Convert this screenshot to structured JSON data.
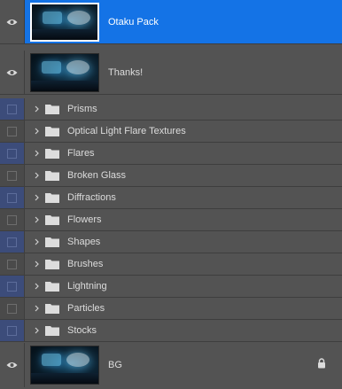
{
  "layers_panel": {
    "top_layers": [
      {
        "name": "Otaku Pack",
        "selected": true,
        "visible": true
      },
      {
        "name": "Thanks!",
        "selected": false,
        "visible": true
      }
    ],
    "groups": [
      {
        "name": "Prisms",
        "color": "blue"
      },
      {
        "name": "Optical Light Flare Textures",
        "color": "gray"
      },
      {
        "name": "Flares",
        "color": "blue"
      },
      {
        "name": "Broken Glass",
        "color": "gray"
      },
      {
        "name": "Diffractions",
        "color": "blue"
      },
      {
        "name": "Flowers",
        "color": "gray"
      },
      {
        "name": "Shapes",
        "color": "blue"
      },
      {
        "name": "Brushes",
        "color": "gray"
      },
      {
        "name": "Lightning",
        "color": "blue"
      },
      {
        "name": "Particles",
        "color": "gray"
      },
      {
        "name": "Stocks",
        "color": "blue"
      }
    ],
    "background_layer": {
      "name": "BG",
      "visible": true,
      "locked": true
    }
  },
  "icons": {
    "visibility": "eye-icon",
    "expand": "chevron-right-icon",
    "group": "folder-icon",
    "lock": "lock-icon"
  },
  "colors": {
    "panel_bg": "#535353",
    "selection": "#1473e6",
    "group_color_blue": "#3c4c7a",
    "group_color_gray": "#4a4a4a"
  }
}
